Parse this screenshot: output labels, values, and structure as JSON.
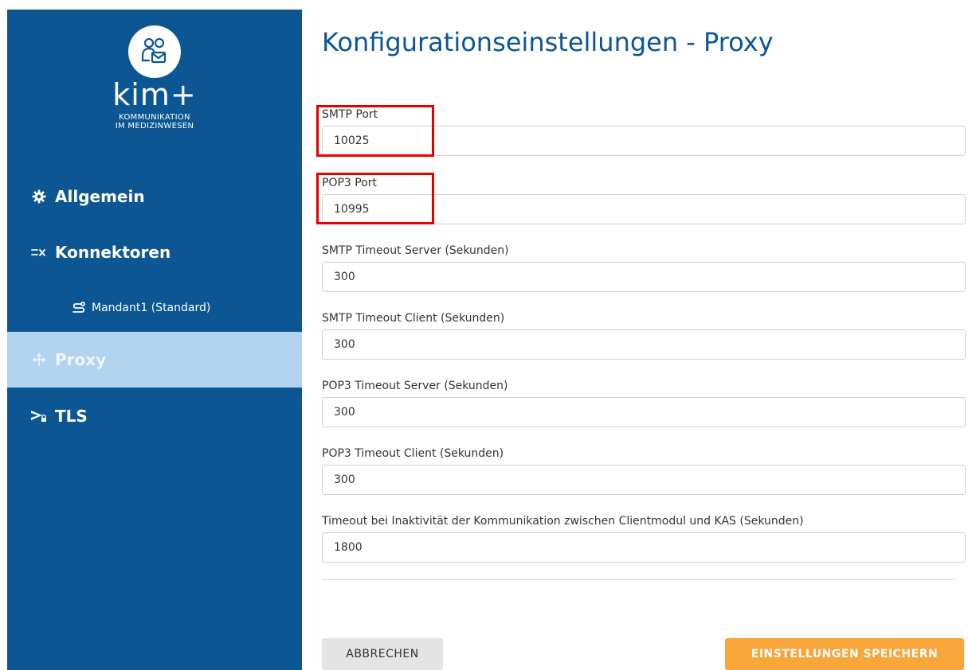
{
  "brand": {
    "name": "kim+",
    "subtitle_line1": "KOMMUNIKATION",
    "subtitle_line2": "IM MEDIZINWESEN"
  },
  "sidebar": {
    "items": [
      {
        "label": "Allgemein",
        "icon": "gear-icon"
      },
      {
        "label": "Konnektoren",
        "icon": "connector-icon"
      },
      {
        "label": "Mandant1 (Standard)",
        "icon": "route-icon"
      },
      {
        "label": "Proxy",
        "icon": "proxy-icon",
        "active": true
      },
      {
        "label": "TLS",
        "icon": "tls-icon"
      }
    ]
  },
  "main": {
    "title": "Konfigurationseinstellungen - Proxy",
    "fields": [
      {
        "label": "SMTP Port",
        "value": "10025"
      },
      {
        "label": "POP3 Port",
        "value": "10995"
      },
      {
        "label": "SMTP Timeout Server (Sekunden)",
        "value": "300"
      },
      {
        "label": "SMTP Timeout Client (Sekunden)",
        "value": "300"
      },
      {
        "label": "POP3 Timeout Server (Sekunden)",
        "value": "300"
      },
      {
        "label": "POP3 Timeout Client (Sekunden)",
        "value": "300"
      },
      {
        "label": "Timeout bei Inaktivität der Kommunikation zwischen Clientmodul und KAS (Sekunden)",
        "value": "1800"
      }
    ],
    "cancel_label": "ABBRECHEN",
    "save_label": "EINSTELLUNGEN SPEICHERN"
  },
  "colors": {
    "sidebar_bg": "#0c5694",
    "active_item_bg": "#b3d4ee",
    "accent_button": "#f8a53a",
    "highlight_box": "#e60000"
  }
}
